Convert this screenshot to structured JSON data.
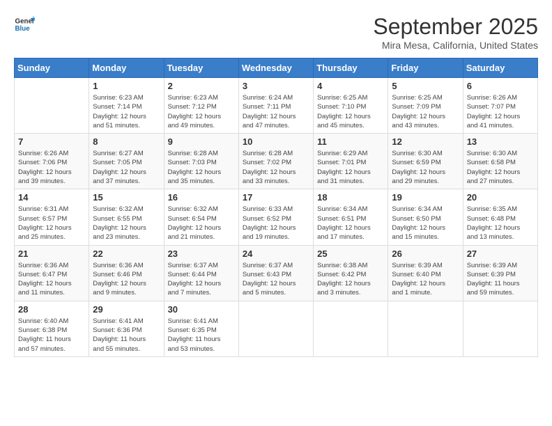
{
  "header": {
    "logo_line1": "General",
    "logo_line2": "Blue",
    "month": "September 2025",
    "location": "Mira Mesa, California, United States"
  },
  "weekdays": [
    "Sunday",
    "Monday",
    "Tuesday",
    "Wednesday",
    "Thursday",
    "Friday",
    "Saturday"
  ],
  "weeks": [
    [
      {
        "day": "",
        "info": ""
      },
      {
        "day": "1",
        "info": "Sunrise: 6:23 AM\nSunset: 7:14 PM\nDaylight: 12 hours\nand 51 minutes."
      },
      {
        "day": "2",
        "info": "Sunrise: 6:23 AM\nSunset: 7:12 PM\nDaylight: 12 hours\nand 49 minutes."
      },
      {
        "day": "3",
        "info": "Sunrise: 6:24 AM\nSunset: 7:11 PM\nDaylight: 12 hours\nand 47 minutes."
      },
      {
        "day": "4",
        "info": "Sunrise: 6:25 AM\nSunset: 7:10 PM\nDaylight: 12 hours\nand 45 minutes."
      },
      {
        "day": "5",
        "info": "Sunrise: 6:25 AM\nSunset: 7:09 PM\nDaylight: 12 hours\nand 43 minutes."
      },
      {
        "day": "6",
        "info": "Sunrise: 6:26 AM\nSunset: 7:07 PM\nDaylight: 12 hours\nand 41 minutes."
      }
    ],
    [
      {
        "day": "7",
        "info": "Sunrise: 6:26 AM\nSunset: 7:06 PM\nDaylight: 12 hours\nand 39 minutes."
      },
      {
        "day": "8",
        "info": "Sunrise: 6:27 AM\nSunset: 7:05 PM\nDaylight: 12 hours\nand 37 minutes."
      },
      {
        "day": "9",
        "info": "Sunrise: 6:28 AM\nSunset: 7:03 PM\nDaylight: 12 hours\nand 35 minutes."
      },
      {
        "day": "10",
        "info": "Sunrise: 6:28 AM\nSunset: 7:02 PM\nDaylight: 12 hours\nand 33 minutes."
      },
      {
        "day": "11",
        "info": "Sunrise: 6:29 AM\nSunset: 7:01 PM\nDaylight: 12 hours\nand 31 minutes."
      },
      {
        "day": "12",
        "info": "Sunrise: 6:30 AM\nSunset: 6:59 PM\nDaylight: 12 hours\nand 29 minutes."
      },
      {
        "day": "13",
        "info": "Sunrise: 6:30 AM\nSunset: 6:58 PM\nDaylight: 12 hours\nand 27 minutes."
      }
    ],
    [
      {
        "day": "14",
        "info": "Sunrise: 6:31 AM\nSunset: 6:57 PM\nDaylight: 12 hours\nand 25 minutes."
      },
      {
        "day": "15",
        "info": "Sunrise: 6:32 AM\nSunset: 6:55 PM\nDaylight: 12 hours\nand 23 minutes."
      },
      {
        "day": "16",
        "info": "Sunrise: 6:32 AM\nSunset: 6:54 PM\nDaylight: 12 hours\nand 21 minutes."
      },
      {
        "day": "17",
        "info": "Sunrise: 6:33 AM\nSunset: 6:52 PM\nDaylight: 12 hours\nand 19 minutes."
      },
      {
        "day": "18",
        "info": "Sunrise: 6:34 AM\nSunset: 6:51 PM\nDaylight: 12 hours\nand 17 minutes."
      },
      {
        "day": "19",
        "info": "Sunrise: 6:34 AM\nSunset: 6:50 PM\nDaylight: 12 hours\nand 15 minutes."
      },
      {
        "day": "20",
        "info": "Sunrise: 6:35 AM\nSunset: 6:48 PM\nDaylight: 12 hours\nand 13 minutes."
      }
    ],
    [
      {
        "day": "21",
        "info": "Sunrise: 6:36 AM\nSunset: 6:47 PM\nDaylight: 12 hours\nand 11 minutes."
      },
      {
        "day": "22",
        "info": "Sunrise: 6:36 AM\nSunset: 6:46 PM\nDaylight: 12 hours\nand 9 minutes."
      },
      {
        "day": "23",
        "info": "Sunrise: 6:37 AM\nSunset: 6:44 PM\nDaylight: 12 hours\nand 7 minutes."
      },
      {
        "day": "24",
        "info": "Sunrise: 6:37 AM\nSunset: 6:43 PM\nDaylight: 12 hours\nand 5 minutes."
      },
      {
        "day": "25",
        "info": "Sunrise: 6:38 AM\nSunset: 6:42 PM\nDaylight: 12 hours\nand 3 minutes."
      },
      {
        "day": "26",
        "info": "Sunrise: 6:39 AM\nSunset: 6:40 PM\nDaylight: 12 hours\nand 1 minute."
      },
      {
        "day": "27",
        "info": "Sunrise: 6:39 AM\nSunset: 6:39 PM\nDaylight: 11 hours\nand 59 minutes."
      }
    ],
    [
      {
        "day": "28",
        "info": "Sunrise: 6:40 AM\nSunset: 6:38 PM\nDaylight: 11 hours\nand 57 minutes."
      },
      {
        "day": "29",
        "info": "Sunrise: 6:41 AM\nSunset: 6:36 PM\nDaylight: 11 hours\nand 55 minutes."
      },
      {
        "day": "30",
        "info": "Sunrise: 6:41 AM\nSunset: 6:35 PM\nDaylight: 11 hours\nand 53 minutes."
      },
      {
        "day": "",
        "info": ""
      },
      {
        "day": "",
        "info": ""
      },
      {
        "day": "",
        "info": ""
      },
      {
        "day": "",
        "info": ""
      }
    ]
  ]
}
